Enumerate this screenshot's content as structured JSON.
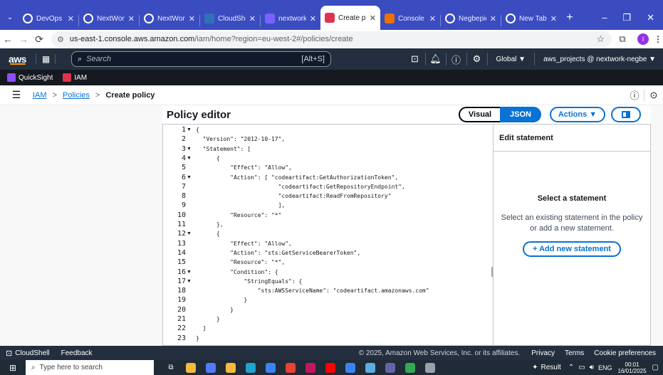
{
  "browser": {
    "tabs": [
      {
        "label": "DevOps (",
        "fav": "github-icon",
        "color": "#ffffff"
      },
      {
        "label": "NextWork",
        "fav": "nextwork-icon",
        "color": "#ffffff"
      },
      {
        "label": "NextWork",
        "fav": "nextwork-icon",
        "color": "#ffffff"
      },
      {
        "label": "CloudShe",
        "fav": "cloudshell-icon",
        "color": "#2e73b8"
      },
      {
        "label": "nextwork",
        "fav": "nextwork-icon",
        "color": "#7b61ff"
      },
      {
        "label": "Create po",
        "fav": "iam-icon",
        "color": "#dd344c"
      },
      {
        "label": "Console I",
        "fav": "console-icon",
        "color": "#ed7100"
      },
      {
        "label": "Negbepic",
        "fav": "github-icon",
        "color": "#ffffff"
      },
      {
        "label": "New Tab",
        "fav": "chrome-icon",
        "color": "#ffffff"
      }
    ],
    "url_domain": "us-east-1.console.aws.amazon.com",
    "url_path": "/iam/home?region=eu-west-2#/policies/create",
    "profile_initial": "I"
  },
  "aws_header": {
    "logo": "aws",
    "search_placeholder": "Search",
    "search_shortcut": "[Alt+S]",
    "region": "Global ▼",
    "account": "aws_projects @ nextwork-negbe ▼"
  },
  "services": [
    {
      "label": "QuickSight",
      "color": "#8c4fff"
    },
    {
      "label": "IAM",
      "color": "#dd344c"
    }
  ],
  "breadcrumb": {
    "items": [
      "IAM",
      "Policies",
      "Create policy"
    ],
    "sep": ">"
  },
  "editor": {
    "title": "Policy editor",
    "visual_label": "Visual",
    "json_label": "JSON",
    "actions_label": "Actions ▼"
  },
  "code_lines": [
    {
      "n": "1",
      "fold": true,
      "t": "{"
    },
    {
      "n": "2",
      "fold": false,
      "t": "  \"Version\": \"2012-10-17\","
    },
    {
      "n": "3",
      "fold": true,
      "t": "  \"Statement\": ["
    },
    {
      "n": "4",
      "fold": true,
      "t": "      {"
    },
    {
      "n": "5",
      "fold": false,
      "t": "          \"Effect\": \"Allow\","
    },
    {
      "n": "6",
      "fold": true,
      "t": "          \"Action\": [ \"codeartifact:GetAuthorizationToken\","
    },
    {
      "n": "7",
      "fold": false,
      "t": "                        \"codeartifact:GetRepositoryEndpoint\","
    },
    {
      "n": "8",
      "fold": false,
      "t": "                        \"codeartifact:ReadFromRepository\""
    },
    {
      "n": "9",
      "fold": false,
      "t": "                        ],"
    },
    {
      "n": "10",
      "fold": false,
      "t": "          \"Resource\": \"*\""
    },
    {
      "n": "11",
      "fold": false,
      "t": "      },"
    },
    {
      "n": "12",
      "fold": true,
      "t": "      {"
    },
    {
      "n": "13",
      "fold": false,
      "t": "          \"Effect\": \"Allow\","
    },
    {
      "n": "14",
      "fold": false,
      "t": "          \"Action\": \"sts:GetServiceBearerToken\","
    },
    {
      "n": "15",
      "fold": false,
      "t": "          \"Resource\": \"*\","
    },
    {
      "n": "16",
      "fold": true,
      "t": "          \"Condition\": {"
    },
    {
      "n": "17",
      "fold": true,
      "t": "              \"StringEquals\": {"
    },
    {
      "n": "18",
      "fold": false,
      "t": "                  \"sts:AWSServiceName\": \"codeartifact.amazonaws.com\""
    },
    {
      "n": "19",
      "fold": false,
      "t": "              }"
    },
    {
      "n": "20",
      "fold": false,
      "t": "          }"
    },
    {
      "n": "21",
      "fold": false,
      "t": "      }"
    },
    {
      "n": "22",
      "fold": false,
      "t": "  ]"
    },
    {
      "n": "23",
      "fold": false,
      "t": "}"
    }
  ],
  "statement_panel": {
    "header": "Edit statement",
    "title": "Select a statement",
    "description": "Select an existing statement in the policy or add a new statement.",
    "add_button": "+ Add new statement"
  },
  "footer": {
    "cloudshell": "CloudShell",
    "feedback": "Feedback",
    "copyright": "© 2025, Amazon Web Services, Inc. or its affiliates.",
    "privacy": "Privacy",
    "terms": "Terms",
    "cookie": "Cookie preferences"
  },
  "taskbar": {
    "search_placeholder": "Type here to search",
    "result_label": "Result",
    "lang": "ENG",
    "time": "00:01",
    "date": "16/01/2025"
  }
}
